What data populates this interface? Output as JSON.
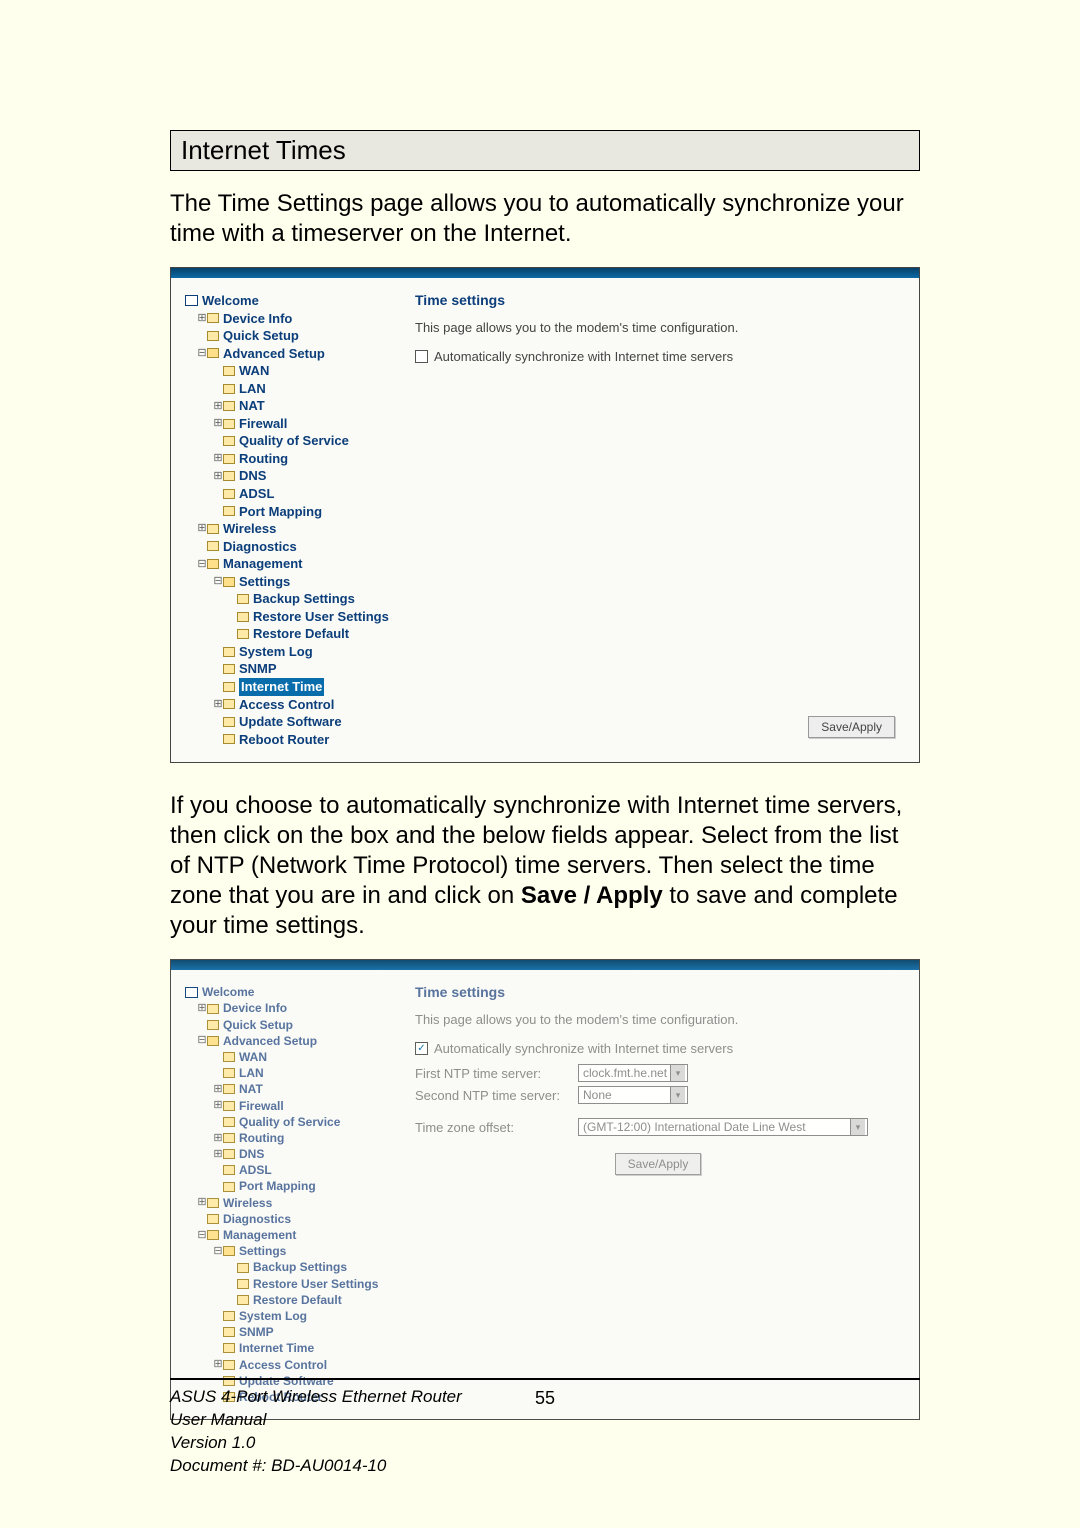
{
  "section": {
    "title": "Internet Times"
  },
  "intro": "The Time Settings page allows you to automatically synchronize your time with a timeserver on the Internet.",
  "mid_text": {
    "p1a": "If you choose to automatically synchronize with Internet time servers, then click on the box and the below fields appear. Select from the list of NTP (Network Time Protocol) time servers. Then select the time zone that you are in and click on ",
    "p1b": "Save / Apply",
    "p1c": " to save and complete your time settings."
  },
  "shot1": {
    "content_title": "Time settings",
    "desc": "This page allows you to the modem's time configuration.",
    "chk_label": "Automatically synchronize with Internet time servers",
    "button": "Save/Apply"
  },
  "shot2": {
    "content_title": "Time settings",
    "desc": "This page allows you to the modem's time configuration.",
    "chk_label": "Automatically synchronize with Internet time servers",
    "first_label": "First NTP time server:",
    "first_val": "clock.fmt.he.net",
    "second_label": "Second NTP time server:",
    "second_val": "None",
    "tz_label": "Time zone offset:",
    "tz_val": "(GMT-12:00) International Date Line West",
    "button": "Save/Apply"
  },
  "tree": {
    "welcome": "Welcome",
    "device_info": "Device Info",
    "quick_setup": "Quick Setup",
    "advanced_setup": "Advanced Setup",
    "wan": "WAN",
    "lan": "LAN",
    "nat": "NAT",
    "firewall": "Firewall",
    "qos": "Quality of Service",
    "routing": "Routing",
    "dns": "DNS",
    "adsl": "ADSL",
    "port_mapping": "Port Mapping",
    "wireless": "Wireless",
    "diagnostics": "Diagnostics",
    "management": "Management",
    "settings": "Settings",
    "backup_settings": "Backup Settings",
    "restore_user": "Restore User Settings",
    "restore_default": "Restore Default",
    "system_log": "System Log",
    "snmp": "SNMP",
    "internet_time": "Internet Time",
    "access_control": "Access Control",
    "update_sw": "Update Software",
    "reboot": "Reboot Router"
  },
  "footer": {
    "line1": "ASUS 4-Port Wireless Ethernet Router",
    "line2": "User Manual",
    "line3": "Version 1.0",
    "line4": "Document #:  BD-AU0014-10",
    "page": "55"
  }
}
